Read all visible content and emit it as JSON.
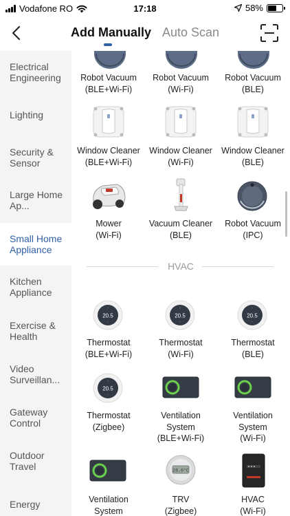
{
  "status": {
    "carrier": "Vodafone RO",
    "time": "17:18",
    "battery": "58%",
    "battery_level": 0.58
  },
  "header": {
    "tabs": [
      {
        "label": "Add Manually",
        "active": true
      },
      {
        "label": "Auto Scan",
        "active": false
      }
    ],
    "back_icon": "chevron-left-icon",
    "scan_icon": "scan-frame-icon"
  },
  "sidebar": {
    "items": [
      {
        "label": "Electrical Engineering"
      },
      {
        "label": "Lighting"
      },
      {
        "label": "Security & Sensor"
      },
      {
        "label": "Large Home Ap..."
      },
      {
        "label": "Small Home Appliance",
        "active": true
      },
      {
        "label": "Kitchen Appliance"
      },
      {
        "label": "Exercise & Health"
      },
      {
        "label": "Video Surveillan..."
      },
      {
        "label": "Gateway Control"
      },
      {
        "label": "Outdoor Travel"
      },
      {
        "label": "Energy"
      }
    ]
  },
  "devices": [
    {
      "line1": "Robot Vacuum",
      "line2": "(BLE+Wi-Fi)",
      "icon": "robot-vacuum-icon"
    },
    {
      "line1": "Robot Vacuum",
      "line2": "(Wi-Fi)",
      "icon": "robot-vacuum-icon"
    },
    {
      "line1": "Robot Vacuum",
      "line2": "(BLE)",
      "icon": "robot-vacuum-icon"
    },
    {
      "line1": "Window Cleaner",
      "line2": "(BLE+Wi-Fi)",
      "icon": "window-cleaner-icon"
    },
    {
      "line1": "Window Cleaner",
      "line2": "(Wi-Fi)",
      "icon": "window-cleaner-icon"
    },
    {
      "line1": "Window Cleaner",
      "line2": "(BLE)",
      "icon": "window-cleaner-icon"
    },
    {
      "line1": "Mower",
      "line2": "(Wi-Fi)",
      "icon": "mower-icon"
    },
    {
      "line1": "Vacuum Cleaner",
      "line2": "(BLE)",
      "icon": "stick-vacuum-icon"
    },
    {
      "line1": "Robot Vacuum",
      "line2": "(IPC)",
      "icon": "robot-vacuum-camera-icon"
    }
  ],
  "hvac": {
    "title": "HVAC",
    "thermostat_reading": "20.5",
    "trv_reading": "26.0°C",
    "devices": [
      {
        "line1": "Thermostat",
        "line2": "(BLE+Wi-Fi)",
        "icon": "thermostat-icon"
      },
      {
        "line1": "Thermostat",
        "line2": "(Wi-Fi)",
        "icon": "thermostat-icon"
      },
      {
        "line1": "Thermostat",
        "line2": "(BLE)",
        "icon": "thermostat-icon"
      },
      {
        "line1": "Thermostat",
        "line2": "(Zigbee)",
        "icon": "thermostat-icon"
      },
      {
        "line1": "Ventilation",
        "line2": "System",
        "line3": "(BLE+Wi-Fi)",
        "icon": "ventilation-panel-icon"
      },
      {
        "line1": "Ventilation",
        "line2": "System",
        "line3": "(Wi-Fi)",
        "icon": "ventilation-panel-icon"
      },
      {
        "line1": "Ventilation",
        "line2": "System",
        "icon": "ventilation-panel-icon"
      },
      {
        "line1": "TRV",
        "line2": "(Zigbee)",
        "icon": "trv-icon"
      },
      {
        "line1": "HVAC",
        "line2": "(Wi-Fi)",
        "icon": "hvac-unit-icon"
      }
    ]
  },
  "colors": {
    "accent": "#2f5fa7",
    "sidebar_bg": "#f4f4f6",
    "text_muted": "#8a8a8a"
  }
}
